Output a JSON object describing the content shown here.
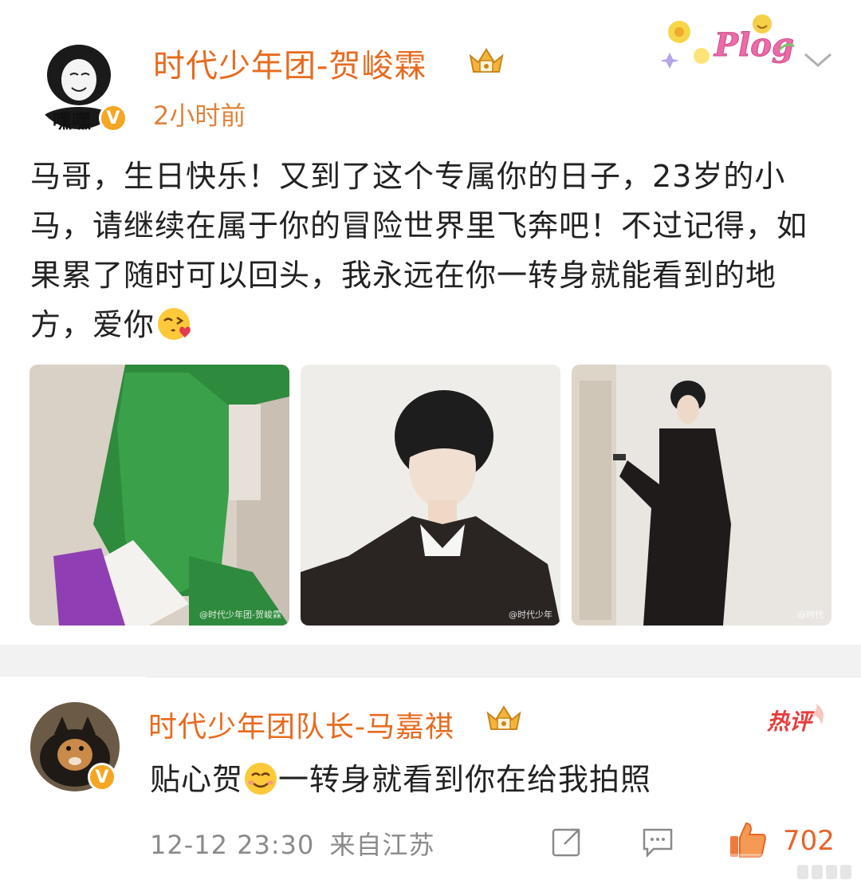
{
  "post": {
    "author": "时代少年团-贺峻霖",
    "avatar_caption": "嘿嘿",
    "time": "2小时前",
    "content_before_emoji": "马哥，生日快乐！又到了这个专属你的日子，23岁的小马，请继续在属于你的冒险世界里飞奔吧！不过记得，如果累了随时可以回头，我永远在你一转身就能看到的地方，爱你",
    "badge_text": "Plog",
    "photos": [
      {
        "watermark": "@时代少年团-贺峻霖"
      },
      {
        "watermark": "@时代少年"
      },
      {
        "watermark": "@时代"
      }
    ]
  },
  "comment": {
    "author": "时代少年团队长-马嘉祺",
    "hot_label": "热评",
    "text_before_emoji": "贴心贺",
    "text_after_emoji": "一转身就看到你在给我拍照",
    "date": "12-12 23:30",
    "location": "来自江苏",
    "like_count": "702"
  },
  "colors": {
    "author": "#e86a1e",
    "time": "#e0823b",
    "meta": "#8a8a8a",
    "verified": "#f5a623"
  },
  "icons": [
    "verified-icon",
    "crown-icon",
    "chevron-down-icon",
    "share-icon",
    "comment-icon",
    "like-icon"
  ]
}
